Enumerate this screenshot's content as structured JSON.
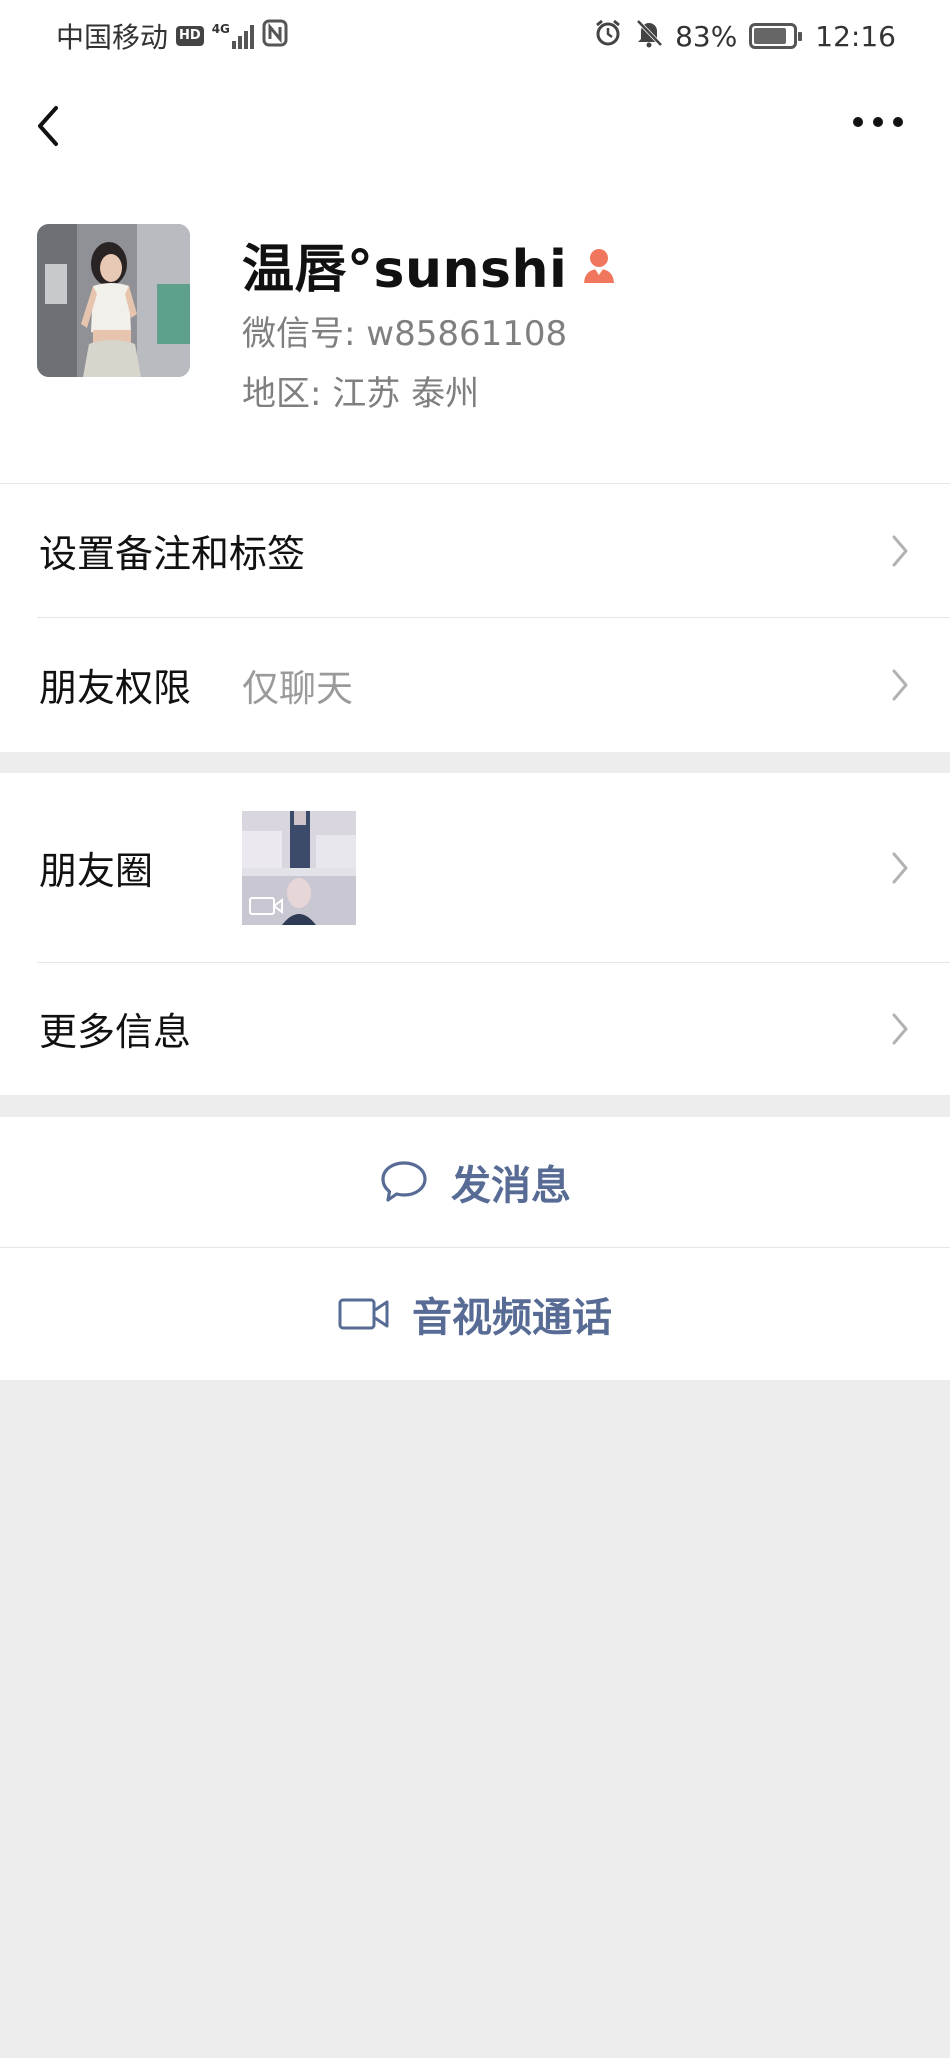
{
  "status_bar": {
    "carrier": "中国移动",
    "hd_badge": "HD",
    "network": "4G",
    "battery": "83%",
    "battery_level": 0.83,
    "time": "12:16"
  },
  "profile": {
    "name": "温唇°sunshi",
    "wechat_id": "微信号: w85861108",
    "region": "地区: 江苏  泰州",
    "gender": "female"
  },
  "menu": {
    "remark_label": "设置备注和标签",
    "permission_label": "朋友权限",
    "permission_value": "仅聊天",
    "moments_label": "朋友圈",
    "more_info_label": "更多信息"
  },
  "actions": {
    "message_label": "发消息",
    "call_label": "音视频通话"
  },
  "colors": {
    "link_blue": "#576b95",
    "gender_female": "#f0765e",
    "background": "#ededed"
  }
}
